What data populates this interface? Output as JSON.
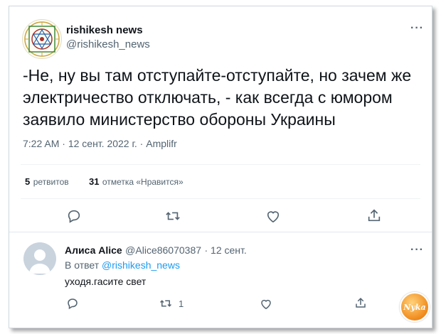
{
  "tweet": {
    "author_name": "rishikesh news",
    "author_handle": "@rishikesh_news",
    "more_label": "···",
    "text": "-Не, ну вы там отступайте-отступайте, но зачем же электричество отключать, - как всегда с юмором заявило министерство обороны Украины",
    "time": "7:22 AM",
    "date": "12 сент. 2022 г.",
    "source": "Amplifr",
    "retweets_count": "5",
    "retweets_label": "ретвитов",
    "likes_count": "31",
    "likes_label": "отметка «Нравится»",
    "actions": [
      "reply-icon",
      "retweet-icon",
      "like-icon",
      "share-icon"
    ]
  },
  "reply": {
    "author_name": "Алиса Alice",
    "author_handle": "@Alice86070387",
    "date": "12 сент.",
    "more_label": "···",
    "in_reply_prefix": "В ответ",
    "in_reply_handle": "@rishikesh_news",
    "text": "уходя.гасите свет",
    "retweet_count": "1",
    "actions": [
      "reply-icon",
      "retweet-icon",
      "like-icon",
      "share-icon"
    ]
  },
  "watermark": {
    "text": "Nуka"
  },
  "colors": {
    "text": "#0f1419",
    "muted": "#536471",
    "link": "#1d9bf0",
    "divider": "#eff3f4"
  }
}
